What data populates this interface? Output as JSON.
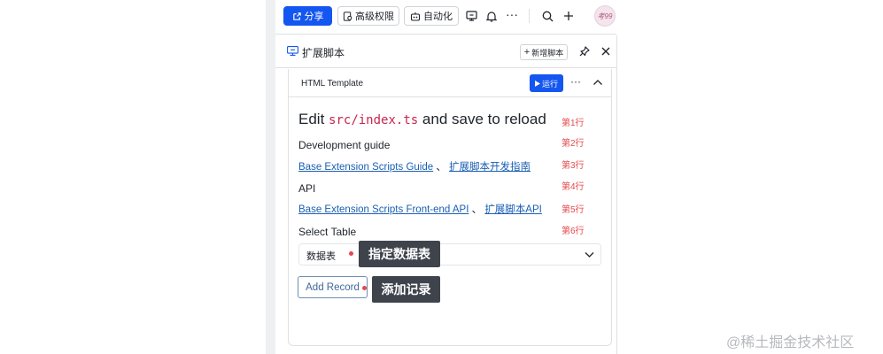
{
  "toolbar": {
    "share_label": "分享",
    "permissions_label": "高级权限",
    "automation_label": "自动化",
    "avatar_text": "考99",
    "icons": [
      "share-icon",
      "permissions-icon",
      "automation-icon",
      "extension-icon",
      "bell-icon",
      "more-icon",
      "search-icon",
      "plus-icon"
    ]
  },
  "panel": {
    "title": "扩展脚本",
    "new_script_label": "新增脚本"
  },
  "script": {
    "name": "HTML Template",
    "run_label": "运行",
    "more": "···"
  },
  "content": {
    "heading_prefix": "Edit",
    "heading_code": "src/index.ts",
    "heading_suffix": "and save to reload",
    "dev_guide_label": "Development guide",
    "guide_link_en": "Base Extension Scripts Guide",
    "guide_sep": "、",
    "guide_link_cn": "扩展脚本开发指南",
    "api_label": "API",
    "api_link_en": "Base Extension Scripts Front-end API",
    "api_sep": "、",
    "api_link_cn": "扩展脚本API",
    "select_table_label": "Select Table",
    "select_value": "数据表",
    "add_record_label": "Add Record"
  },
  "annotations": {
    "line_tags": [
      "第1行",
      "第2行",
      "第3行",
      "第4行",
      "第5行",
      "第6行"
    ],
    "callout_table": "指定数据表",
    "callout_record": "添加记录"
  },
  "watermark": "@稀土掘金技术社区",
  "colors": {
    "primary": "#1456f0",
    "link": "#1a5fb4",
    "annotation_red": "#e5484d",
    "callout_bg": "#3f444c"
  }
}
